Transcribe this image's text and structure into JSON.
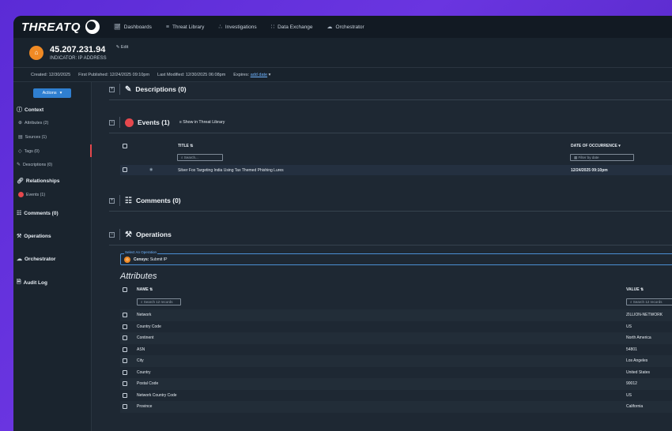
{
  "nav": {
    "logo": "THREATQ",
    "items": [
      {
        "label": "Dashboards",
        "icon": "chart-icon"
      },
      {
        "label": "Threat Library",
        "icon": "library-icon"
      },
      {
        "label": "Investigations",
        "icon": "graph-icon"
      },
      {
        "label": "Data Exchange",
        "icon": "exchange-icon"
      },
      {
        "label": "Orchestrator",
        "icon": "orchestrator-icon"
      }
    ]
  },
  "indicator": {
    "value": "45.207.231.94",
    "type": "INDICATOR: IP ADDRESS",
    "edit_label": "Edit",
    "badge_color": "#f08a24"
  },
  "meta": {
    "created": "Created: 12/30/2025",
    "first_published": "First Published: 12/24/2025 09:10pm",
    "last_modified": "Last Modified: 12/30/2025 06:08pm",
    "expires_label": "Expires:",
    "expires_link": "add date"
  },
  "sidebar": {
    "actions_label": "Actions",
    "context_label": "Context",
    "context_items": [
      {
        "label": "Attributes (2)",
        "icon": "attributes-icon"
      },
      {
        "label": "Sources (1)",
        "icon": "sources-icon"
      },
      {
        "label": "Tags (0)",
        "icon": "tag-icon"
      },
      {
        "label": "Descriptions (0)",
        "icon": "descriptions-icon"
      }
    ],
    "relationships_label": "Relationships",
    "relationship_items": [
      {
        "label": "Events (1)",
        "icon": "event-icon"
      }
    ],
    "comments_label": "Comments (0)",
    "operations_label": "Operations",
    "orchestrator_label": "Orchestrator",
    "audit_label": "Audit Log"
  },
  "descriptions": {
    "title": "Descriptions (0)"
  },
  "events": {
    "title": "Events (1)",
    "show_in_library": "Show in Threat Library",
    "col_title": "TITLE",
    "col_date": "DATE OF OCCURRENCE",
    "search_placeholder": "Search...",
    "date_filter_placeholder": "Filter by date",
    "rows": [
      {
        "title": "Silver Fox Targeting India Using Tax Themed Phishing Lures",
        "date": "12/24/2025 09:10pm"
      }
    ]
  },
  "comments": {
    "title": "Comments (0)"
  },
  "operations": {
    "title": "Operations",
    "select_label": "Select An Operation",
    "selected_prefix": "Censys:",
    "selected_value": "Submit IP"
  },
  "attributes": {
    "title": "Attributes",
    "col_name": "NAME",
    "col_value": "VALUE",
    "search_name_placeholder": "Search 12 records",
    "search_value_placeholder": "Search 12 records",
    "rows": [
      {
        "name": "Network",
        "value": "ZILLION-NETWORK"
      },
      {
        "name": "Country Code",
        "value": "US"
      },
      {
        "name": "Continent",
        "value": "North America"
      },
      {
        "name": "ASN",
        "value": "54801"
      },
      {
        "name": "City",
        "value": "Los Angeles"
      },
      {
        "name": "Country",
        "value": "United States"
      },
      {
        "name": "Postal Code",
        "value": "90012"
      },
      {
        "name": "Network Country Code",
        "value": "US"
      },
      {
        "name": "Province",
        "value": "California"
      }
    ]
  }
}
